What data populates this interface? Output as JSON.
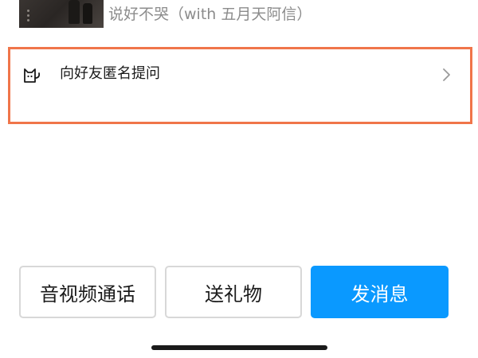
{
  "song": {
    "title": "说好不哭（with 五月天阿信）",
    "thumbnail_icon": "album-cover-image"
  },
  "anonymous_question": {
    "label": "向好友匿名提问",
    "icon": "cat-icon",
    "chevron_icon": "chevron-right-icon",
    "highlight_color": "#f0754a"
  },
  "actions": {
    "call_label": "音视频通话",
    "gift_label": "送礼物",
    "message_label": "发消息",
    "primary_color": "#0a99ff"
  }
}
